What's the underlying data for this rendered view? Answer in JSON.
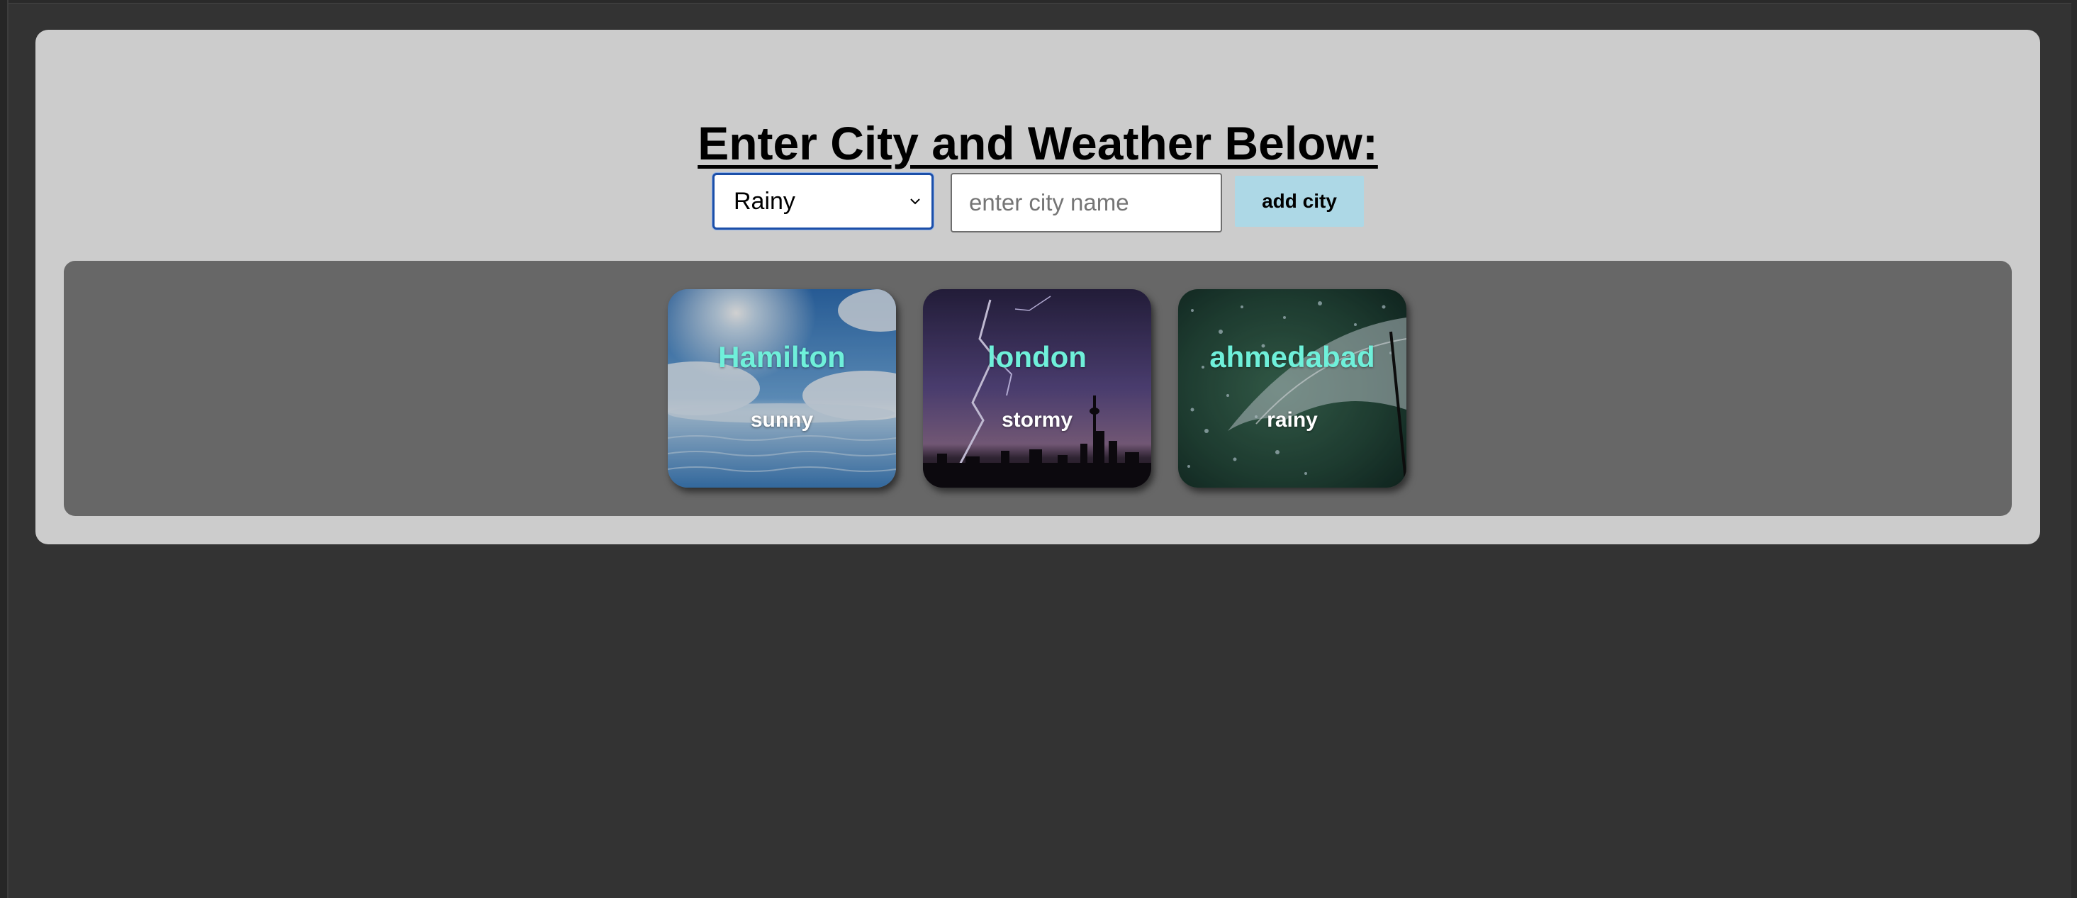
{
  "heading": "Enter City and Weather Below:",
  "form": {
    "weather_select_value": "Rainy",
    "city_input_value": "",
    "city_input_placeholder": "enter city name",
    "add_button_label": "add city"
  },
  "cards": [
    {
      "city": "Hamilton",
      "weather": "sunny",
      "background": "sunny-sky-water-image"
    },
    {
      "city": "london",
      "weather": "stormy",
      "background": "lightning-city-skyline-image"
    },
    {
      "city": "ahmedabad",
      "weather": "rainy",
      "background": "umbrella-rain-image"
    }
  ],
  "colors": {
    "page_background": "#333333",
    "panel_background": "#cccccc",
    "cards_area_background": "#676767",
    "city_text": "#6ff0da",
    "weather_text": "#ffffff",
    "button_background": "#add8e6",
    "select_focus_border": "#1c4fa8"
  },
  "icons": {
    "select_arrow": "chevron-down-icon"
  }
}
